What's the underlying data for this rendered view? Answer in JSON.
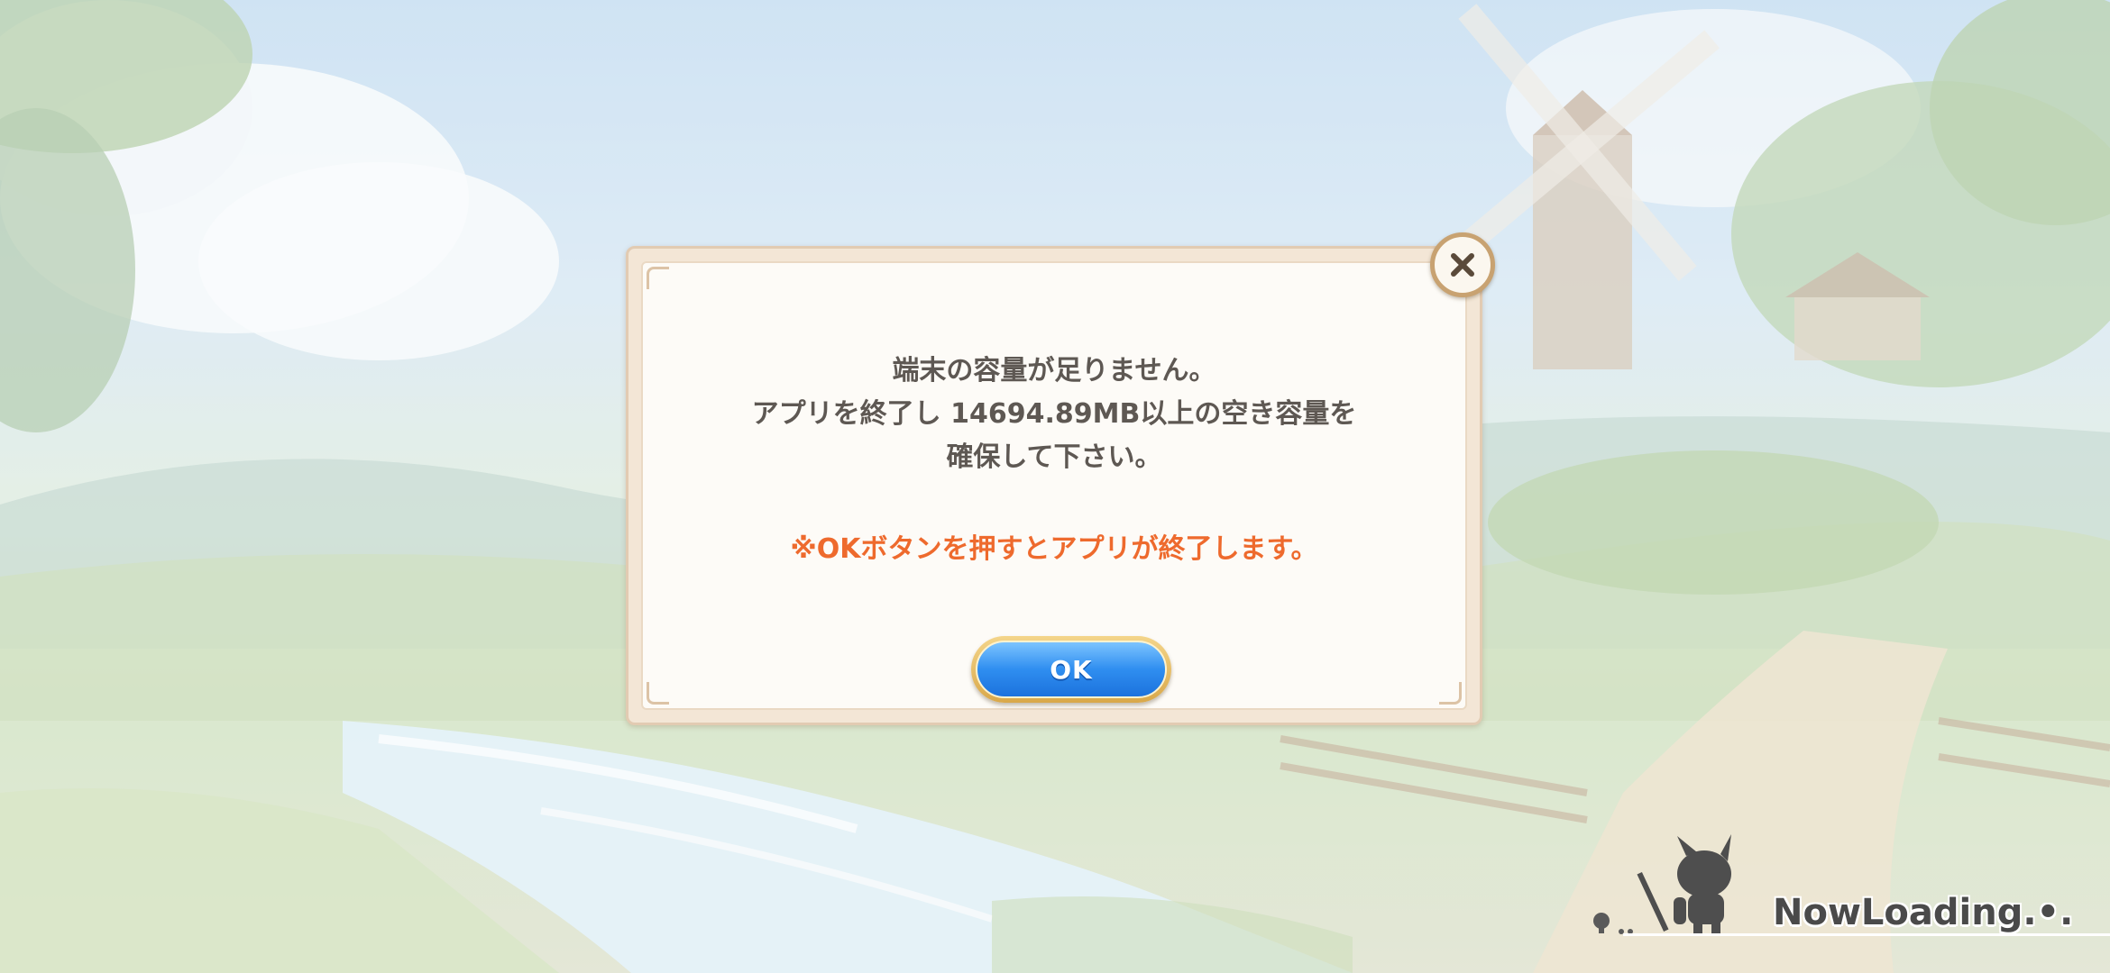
{
  "dialog": {
    "message_lines": [
      "端末の容量が足りません。",
      "アプリを終了し 14694.89MB以上の空き容量を",
      "確保して下さい。"
    ],
    "note": "※OKボタンを押すとアプリが終了します。",
    "ok_label": "OK",
    "close_icon": "close-icon"
  },
  "loading": {
    "text": "NowLoading.•.",
    "icon": "chibi-character-icon"
  },
  "colors": {
    "message": "#5e5853",
    "note": "#ee6a2d",
    "ok_button": "#2f8ef0",
    "frame": "#c8a271"
  }
}
